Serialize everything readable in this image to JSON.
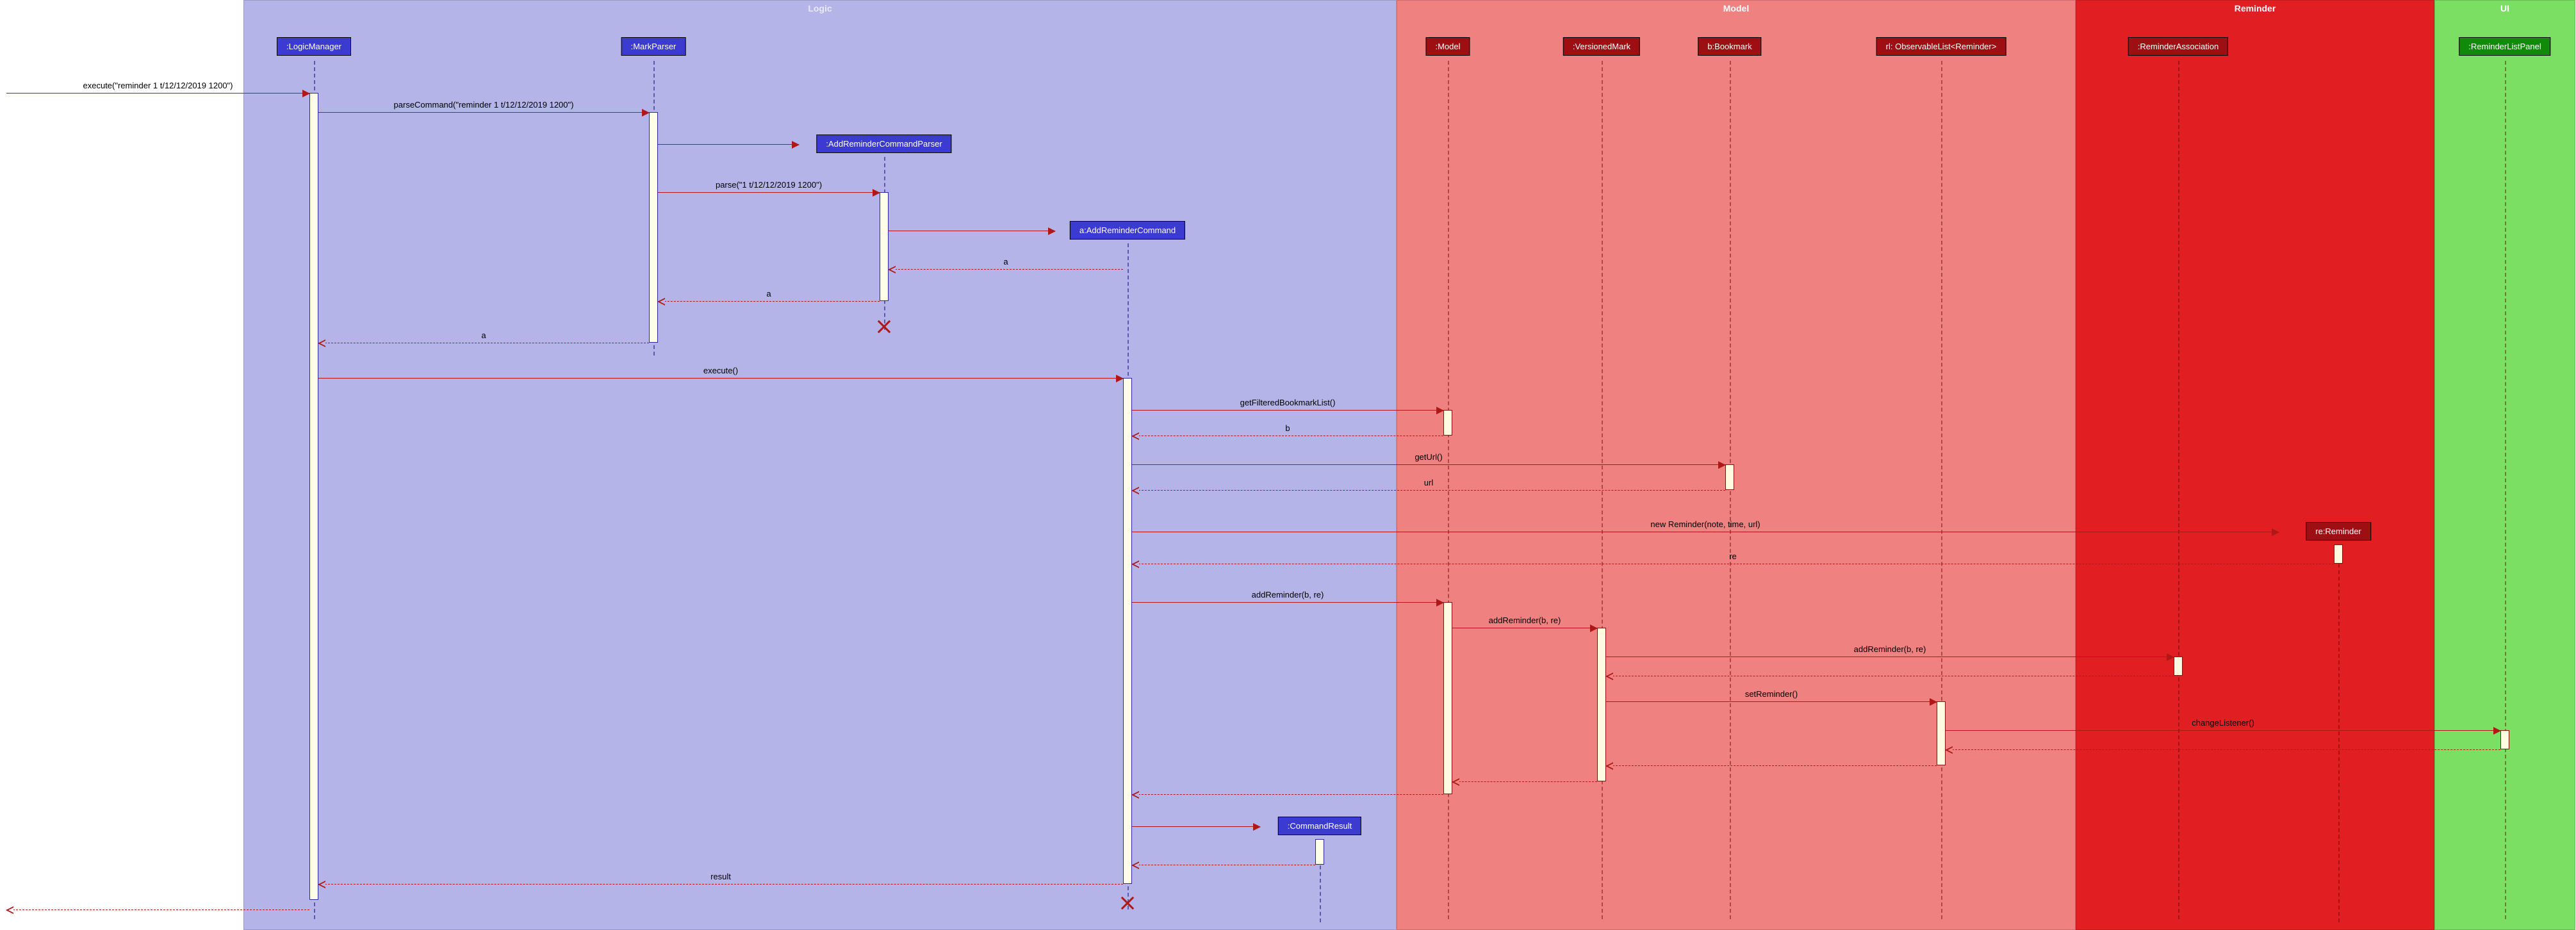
{
  "regions": {
    "logic": "Logic",
    "model": "Model",
    "reminder": "Reminder",
    "ui": "UI"
  },
  "participants": {
    "logicManager": ":LogicManager",
    "markParser": ":MarkParser",
    "addReminderCommandParser": ":AddReminderCommandParser",
    "addReminderCommand": "a:AddReminderCommand",
    "commandResult": ":CommandResult",
    "model": ":Model",
    "versionedMark": ":VersionedMark",
    "bookmark": "b:Bookmark",
    "observableList": "rl: ObservableList<Reminder>",
    "reminderAssociation": ":ReminderAssociation",
    "reReminder": "re:Reminder",
    "reminderListPanel": ":ReminderListPanel"
  },
  "messages": {
    "execute_cmd": "execute(\"reminder 1 t/12/12/2019 1200\")",
    "parseCommand": "parseCommand(\"reminder 1 t/12/12/2019 1200\")",
    "parse": "parse(\"1 t/12/12/2019 1200\")",
    "ret_a1": "a",
    "ret_a2": "a",
    "ret_a3": "a",
    "execute": "execute()",
    "getFilteredBookmarkList": "getFilteredBookmarkList()",
    "ret_b": "b",
    "getUrl": "getUrl()",
    "ret_url": "url",
    "newReminder": "new Reminder(note, time, url)",
    "ret_re": "re",
    "addReminder1": "addReminder(b, re)",
    "addReminder2": "addReminder(b, re)",
    "addReminder3": "addReminder(b, re)",
    "setReminder": "setReminder()",
    "changeListener": "changeListener()",
    "ret_result": "result"
  },
  "chart_data": {
    "type": "sequence-diagram",
    "regions": [
      {
        "name": "Logic",
        "participants": [
          "LogicManager",
          "MarkParser",
          "AddReminderCommandParser",
          "a:AddReminderCommand",
          "CommandResult"
        ]
      },
      {
        "name": "Model",
        "participants": [
          "Model",
          "VersionedMark",
          "b:Bookmark",
          "rl: ObservableList<Reminder>"
        ]
      },
      {
        "name": "Reminder",
        "participants": [
          "ReminderAssociation",
          "re:Reminder"
        ]
      },
      {
        "name": "UI",
        "participants": [
          "ReminderListPanel"
        ]
      }
    ],
    "messages": [
      {
        "from": "外部",
        "to": "LogicManager",
        "label": "execute(\"reminder 1 t/12/12/2019 1200\")",
        "type": "sync"
      },
      {
        "from": "LogicManager",
        "to": "MarkParser",
        "label": "parseCommand(\"reminder 1 t/12/12/2019 1200\")",
        "type": "sync"
      },
      {
        "from": "MarkParser",
        "to": "AddReminderCommandParser",
        "label": "<<create>>",
        "type": "create"
      },
      {
        "from": "MarkParser",
        "to": "AddReminderCommandParser",
        "label": "parse(\"1 t/12/12/2019 1200\")",
        "type": "sync"
      },
      {
        "from": "AddReminderCommandParser",
        "to": "a:AddReminderCommand",
        "label": "<<create>>",
        "type": "create"
      },
      {
        "from": "a:AddReminderCommand",
        "to": "AddReminderCommandParser",
        "label": "a",
        "type": "return"
      },
      {
        "from": "AddReminderCommandParser",
        "to": "MarkParser",
        "label": "a",
        "type": "return"
      },
      {
        "from": "AddReminderCommandParser",
        "to": "AddReminderCommandParser",
        "label": "X",
        "type": "destroy"
      },
      {
        "from": "MarkParser",
        "to": "LogicManager",
        "label": "a",
        "type": "return"
      },
      {
        "from": "LogicManager",
        "to": "a:AddReminderCommand",
        "label": "execute()",
        "type": "sync"
      },
      {
        "from": "a:AddReminderCommand",
        "to": "Model",
        "label": "getFilteredBookmarkList()",
        "type": "sync"
      },
      {
        "from": "Model",
        "to": "a:AddReminderCommand",
        "label": "b",
        "type": "return"
      },
      {
        "from": "a:AddReminderCommand",
        "to": "b:Bookmark",
        "label": "getUrl()",
        "type": "sync"
      },
      {
        "from": "b:Bookmark",
        "to": "a:AddReminderCommand",
        "label": "url",
        "type": "return"
      },
      {
        "from": "a:AddReminderCommand",
        "to": "re:Reminder",
        "label": "new Reminder(note, time, url)",
        "type": "create"
      },
      {
        "from": "re:Reminder",
        "to": "a:AddReminderCommand",
        "label": "re",
        "type": "return"
      },
      {
        "from": "a:AddReminderCommand",
        "to": "Model",
        "label": "addReminder(b, re)",
        "type": "sync"
      },
      {
        "from": "Model",
        "to": "VersionedMark",
        "label": "addReminder(b, re)",
        "type": "sync"
      },
      {
        "from": "VersionedMark",
        "to": "ReminderAssociation",
        "label": "addReminder(b, re)",
        "type": "sync"
      },
      {
        "from": "ReminderAssociation",
        "to": "VersionedMark",
        "label": "",
        "type": "return"
      },
      {
        "from": "VersionedMark",
        "to": "rl: ObservableList<Reminder>",
        "label": "setReminder()",
        "type": "sync"
      },
      {
        "from": "rl: ObservableList<Reminder>",
        "to": "ReminderListPanel",
        "label": "changeListener()",
        "type": "sync"
      },
      {
        "from": "ReminderListPanel",
        "to": "rl: ObservableList<Reminder>",
        "label": "",
        "type": "return"
      },
      {
        "from": "rl: ObservableList<Reminder>",
        "to": "VersionedMark",
        "label": "",
        "type": "return"
      },
      {
        "from": "VersionedMark",
        "to": "Model",
        "label": "",
        "type": "return"
      },
      {
        "from": "Model",
        "to": "a:AddReminderCommand",
        "label": "",
        "type": "return"
      },
      {
        "from": "a:AddReminderCommand",
        "to": "CommandResult",
        "label": "<<create>>",
        "type": "create"
      },
      {
        "from": "CommandResult",
        "to": "a:AddReminderCommand",
        "label": "",
        "type": "return"
      },
      {
        "from": "a:AddReminderCommand",
        "to": "LogicManager",
        "label": "result",
        "type": "return"
      },
      {
        "from": "a:AddReminderCommand",
        "to": "a:AddReminderCommand",
        "label": "X",
        "type": "destroy"
      },
      {
        "from": "LogicManager",
        "to": "外部",
        "label": "",
        "type": "return"
      }
    ]
  }
}
